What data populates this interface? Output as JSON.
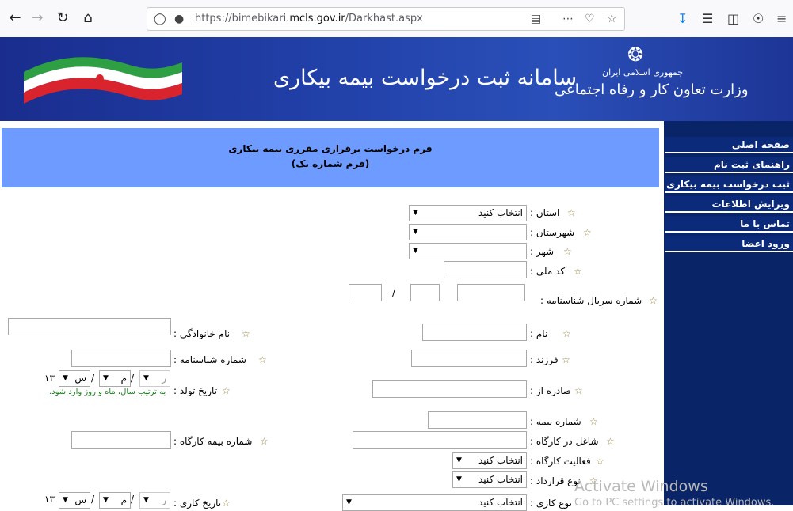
{
  "browser": {
    "url_prefix": "https://bimebikari.",
    "url_domain": "mcls.gov.ir",
    "url_path": "/Darkhast.aspx"
  },
  "banner": {
    "title": "سامانه ثبت درخواست بیمه بیکاری",
    "republic": "جمهوری اسلامی ایران",
    "ministry": "وزارت تعاون کار و رفاه اجتماعی"
  },
  "sidebar": {
    "items": [
      {
        "label": "صفحه اصلی"
      },
      {
        "label": "راهنمای ثبت نام"
      },
      {
        "label": "ثبت درخواست بیمه بیکاری"
      },
      {
        "label": "ویرایش اطلاعات"
      },
      {
        "label": "تماس با ما"
      },
      {
        "label": "ورود اعضا"
      }
    ]
  },
  "form": {
    "title": "فرم درخواست برقراری مقرری بیمه بیکاری",
    "subtitle": "(فرم شماره یک)",
    "province_label": "استان :",
    "province_value": "انتخاب کنید",
    "county_label": "شهرستان :",
    "city_label": "شهر :",
    "national_code_label": "کد ملی :",
    "id_serial_label": "شماره سریال شناسنامه :",
    "serial_sep": "/",
    "first_name_label": "نام :",
    "last_name_label": "نام خانوادگی :",
    "child_of_label": "فرزند :",
    "id_number_label": "شماره شناسنامه :",
    "issued_label": "صادره از :",
    "birth_date_label": "تاریخ تولد :",
    "date_sep": "/",
    "year_prefix": "۱۳",
    "year_placeholder": "س",
    "month_placeholder": "م",
    "day_placeholder": "ر",
    "date_note": "به ترتیب سال، ماه و روز وارد شود.",
    "insurance_no_label": "شماره بیمه :",
    "workplace_label": "شاغل در کارگاه :",
    "workplace_ins_label": "شماره بیمه کارگاه :",
    "activity_label": "فعالیت کارگاه :",
    "activity_value": "انتخاب کنید",
    "contract_label": "نوع قرارداد :",
    "contract_value": "انتخاب کنید",
    "work_type_label": "نوع کاری :",
    "work_type_value": "انتخاب کنید",
    "work_date_label": "تاریخ کاری :"
  },
  "watermark": {
    "line1": "Activate Windows",
    "line2": "Go to PC settings to activate Windows."
  }
}
